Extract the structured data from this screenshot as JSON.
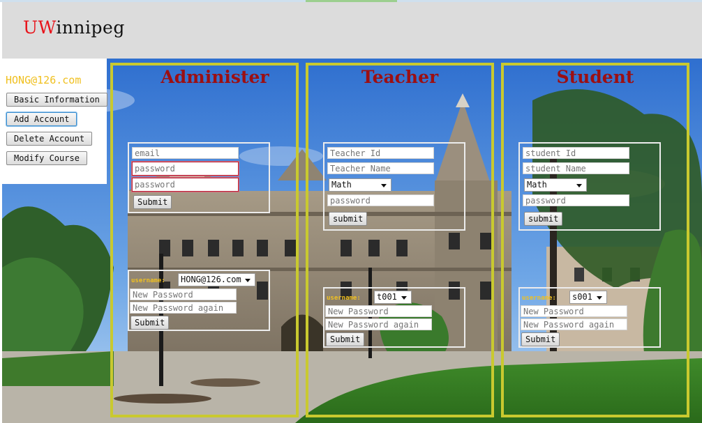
{
  "header": {
    "brand_prefix": "UW",
    "brand_rest": "innipeg"
  },
  "sidebar": {
    "user_email": "HONG@126.com",
    "items": [
      {
        "label": "Basic Information"
      },
      {
        "label": "Add Account"
      },
      {
        "label": "Delete Account"
      },
      {
        "label": "Modify Course"
      }
    ],
    "active_item": "Add Account"
  },
  "administer": {
    "title": "Administer",
    "add_form": {
      "email_placeholder": "email",
      "password_placeholder": "password",
      "password_confirm_placeholder": "password",
      "submit_label": "Submit"
    },
    "reset_form": {
      "username_label": "username:",
      "username_value": "HONG@126.com",
      "new_password_placeholder": "New Password",
      "new_password_again_placeholder": "New Password again",
      "submit_label": "Submit"
    }
  },
  "teacher": {
    "title": "Teacher",
    "add_form": {
      "id_placeholder": "Teacher Id",
      "name_placeholder": "Teacher Name",
      "course_value": "Math",
      "password_placeholder": "password",
      "submit_label": "submit"
    },
    "reset_form": {
      "username_label": "username:",
      "username_value": "t001",
      "new_password_placeholder": "New Password",
      "new_password_again_placeholder": "New Password again",
      "submit_label": "Submit"
    }
  },
  "student": {
    "title": "Student",
    "add_form": {
      "id_placeholder": "student Id",
      "name_placeholder": "student Name",
      "course_value": "Math",
      "password_placeholder": "password",
      "submit_label": "submit"
    },
    "reset_form": {
      "username_label": "username:",
      "username_value": "s001",
      "new_password_placeholder": "New Password",
      "new_password_again_placeholder": "New Password again",
      "submit_label": "Submit"
    }
  },
  "colors": {
    "brand_accent": "#e8141b",
    "panel_border": "#c9c92f",
    "panel_title": "#9c0f12",
    "highlight_text": "#f0c020"
  }
}
